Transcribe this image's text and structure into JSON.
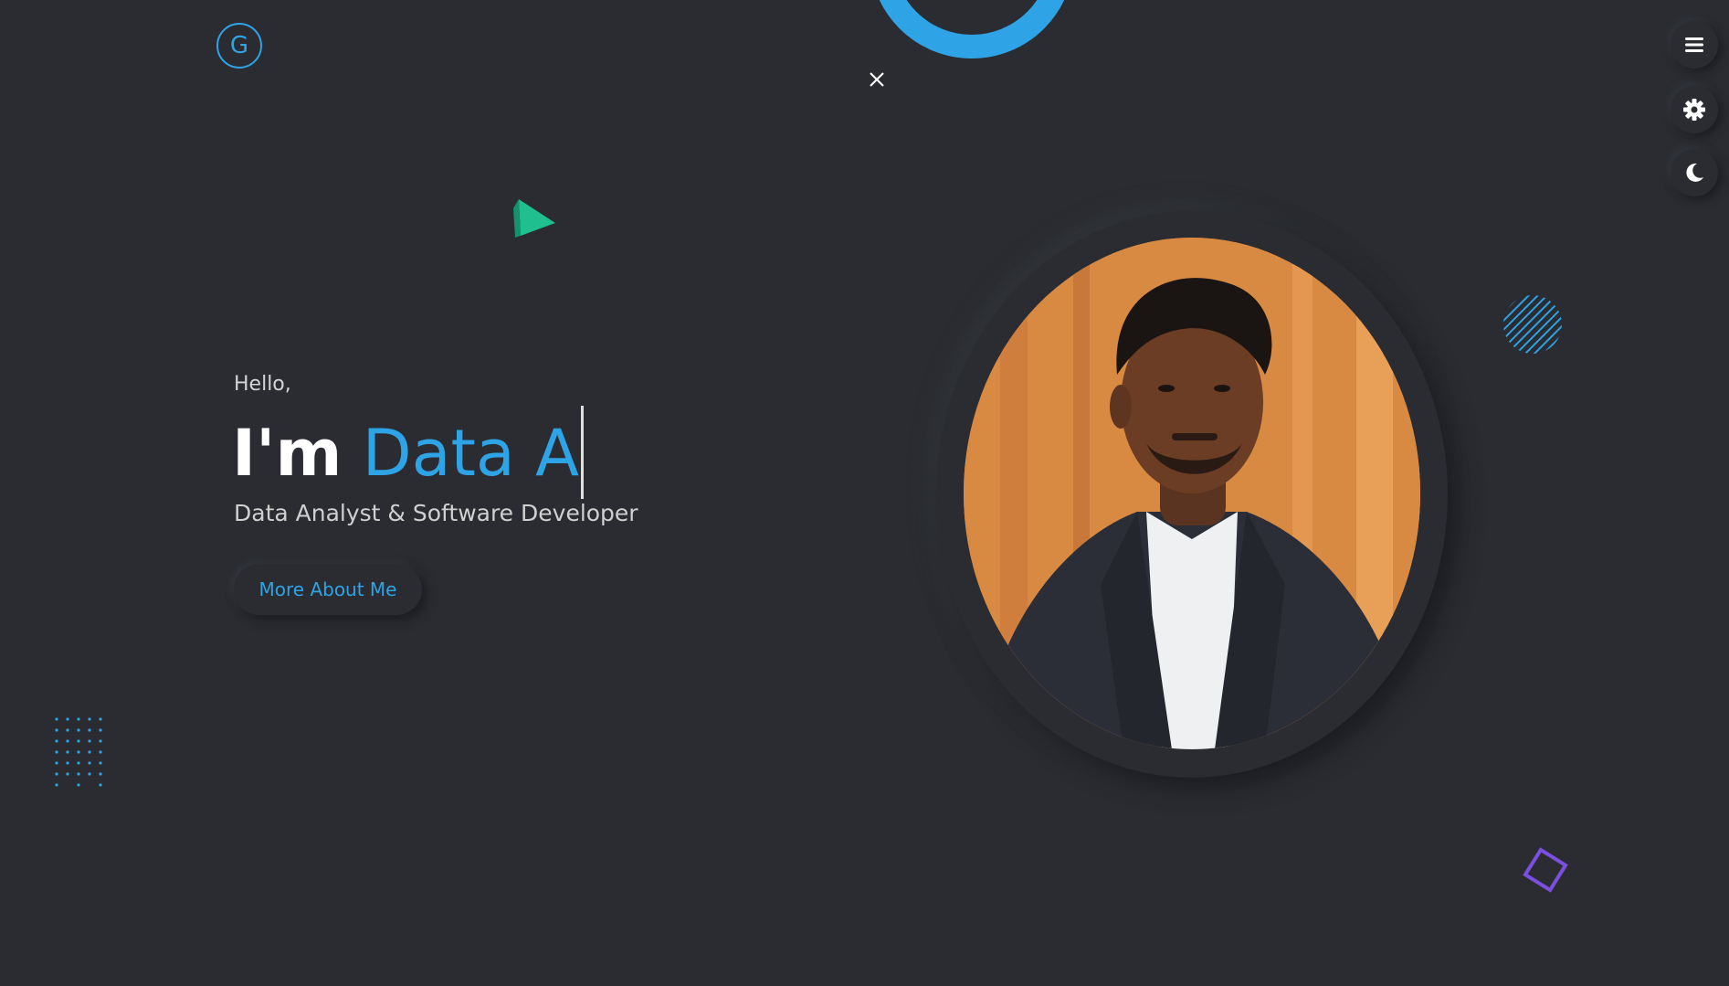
{
  "logo": {
    "letter": "G",
    "icon": "logo-g-icon"
  },
  "controls": {
    "close_icon": "close-icon",
    "menu_icon": "hamburger-menu-icon",
    "settings_icon": "gear-icon",
    "theme_icon": "moon-icon"
  },
  "hero": {
    "greeting": "Hello,",
    "im": "I'm",
    "typed_role": "Data A",
    "subtitle": "Data Analyst & Software Developer",
    "cta_label": "More About Me"
  },
  "colors": {
    "background": "#2a2c31",
    "accent": "#2ea4e6",
    "triangle": "#1fbf8f",
    "diamond": "#7b4fe0"
  }
}
